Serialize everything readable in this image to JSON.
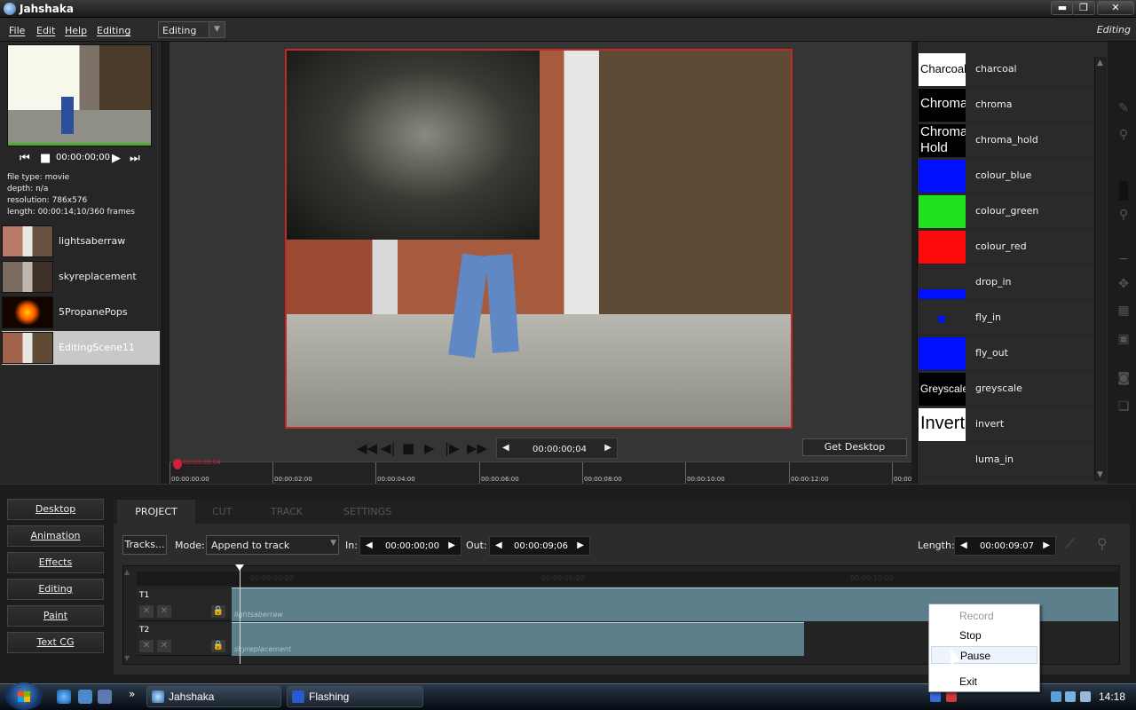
{
  "window": {
    "title": "Jahshaka",
    "min": "▬",
    "max": "❐",
    "close": "✕"
  },
  "menu": {
    "items": [
      "File",
      "Edit",
      "Help",
      "Editing"
    ],
    "mode_select": "Editing",
    "mode_right": "Editing"
  },
  "left_panel": {
    "timecode": "00:00:00;00",
    "info": [
      "file type: movie",
      "depth: n/a",
      "resolution: 786x576",
      "length: 00:00:14;10/360 frames"
    ],
    "clips": [
      "lightsaberraw",
      "skyreplacement",
      "5PropanePops",
      "EditingScene11"
    ]
  },
  "viewer": {
    "timecode": "00:00:00;04",
    "get_desktop": "Get Desktop",
    "ruler_labels": [
      "00:00:00:00",
      "00:00:02:00",
      "00:00:04:00",
      "00:00:06:00",
      "00:00:08:00",
      "00:00:10:00",
      "00:00:12:00",
      "00:00"
    ],
    "playhead_label": "00:00:00:04"
  },
  "effects": {
    "items": [
      {
        "name": "charcoal",
        "thumb": "Charcoal",
        "thumb_style": "white"
      },
      {
        "name": "chroma",
        "thumb": "Chroma",
        "thumb_style": "black"
      },
      {
        "name": "chroma_hold",
        "thumb": "Chroma Hold",
        "thumb_style": "black"
      },
      {
        "name": "colour_blue",
        "thumb": "",
        "color": "#0010ff"
      },
      {
        "name": "colour_green",
        "thumb": "",
        "color": "#20e020"
      },
      {
        "name": "colour_red",
        "thumb": "",
        "color": "#ff0a0a"
      },
      {
        "name": "drop_in",
        "thumb": "",
        "color": "#0010ff"
      },
      {
        "name": "fly_in",
        "thumb": "",
        "color": "#0010ff"
      },
      {
        "name": "fly_out",
        "thumb": "",
        "color": "#0010ff"
      },
      {
        "name": "greyscale",
        "thumb": "Greyscale",
        "thumb_style": "black"
      },
      {
        "name": "invert",
        "thumb": "Invert",
        "thumb_style": "white"
      },
      {
        "name": "luma_in",
        "thumb": "",
        "color": "#2a2a2a"
      }
    ]
  },
  "nav": {
    "items": [
      "Desktop",
      "Animation",
      "Effects",
      "Editing",
      "Paint",
      "Text CG"
    ]
  },
  "tabs": {
    "project": "PROJECT",
    "cut": "CUT",
    "track": "TRACK",
    "settings": "SETTINGS"
  },
  "edit": {
    "tracks_btn": "Tracks...",
    "mode_label": "Mode:",
    "mode_value": "Append to track",
    "in_label": "In:",
    "in_value": "00:00:00;00",
    "out_label": "Out:",
    "out_value": "00:00:09;06",
    "length_label": "Length:",
    "length_value": "00:00:09:07"
  },
  "timeline": {
    "tracks": [
      {
        "name": "T1",
        "clip": "lightsaberraw"
      },
      {
        "name": "T2",
        "clip": "skyreplacement"
      }
    ],
    "ruler_labels": [
      "00:00:00:00",
      "00:00:05:00",
      "00:00:10:00"
    ]
  },
  "context_menu": {
    "items": [
      "Record",
      "Stop",
      "Pause",
      "Exit"
    ]
  },
  "taskbar": {
    "items": [
      "Jahshaka",
      "Flashing"
    ],
    "clock": "14:18",
    "more": "»"
  }
}
